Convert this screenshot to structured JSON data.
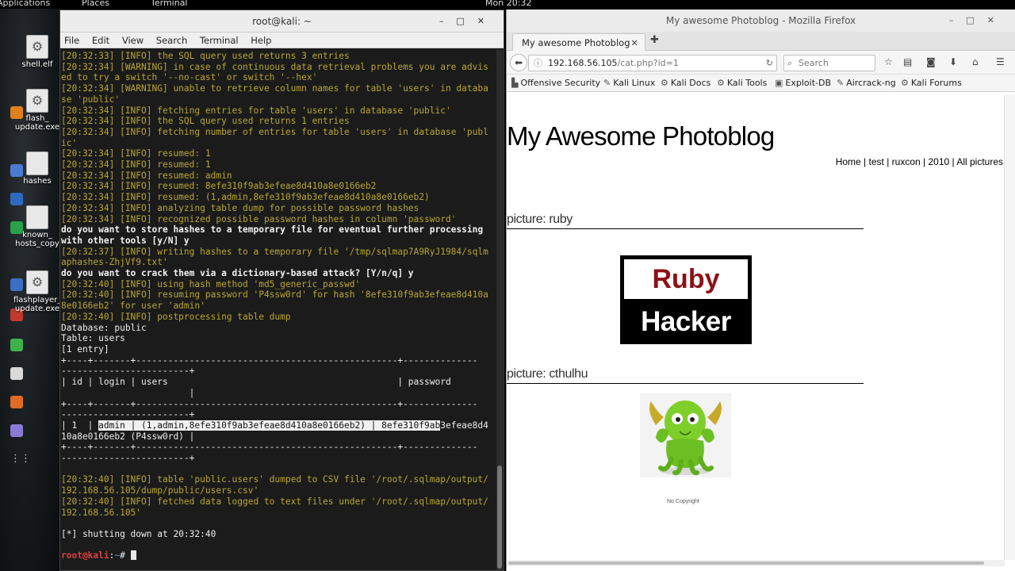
{
  "topbar": {
    "applications": "Applications",
    "places": "Places",
    "terminal": "Terminal",
    "clock": "Mon 20:32"
  },
  "desktop_icons": [
    {
      "label": "shell.elf",
      "icon": "gear-icon"
    },
    {
      "label": "flash_\nupdate.exe",
      "icon": "gear-icon"
    },
    {
      "label": "hashes",
      "icon": "document-icon"
    },
    {
      "label": "known_\nhosts_copy",
      "icon": "document-icon"
    },
    {
      "label": "flashplayer_\nupdate.exe",
      "icon": "gear-icon"
    }
  ],
  "terminal": {
    "title": "root@kali: ~",
    "menu": [
      "File",
      "Edit",
      "View",
      "Search",
      "Terminal",
      "Help"
    ],
    "lines": [
      {
        "c": "y",
        "t": "[20:32:33] [INFO] the SQL query used returns 3 entries"
      },
      {
        "c": "y",
        "t": "[20:32:34] [WARNING] in case of continuous data retrieval problems you are advis"
      },
      {
        "c": "y",
        "t": "ed to try a switch '--no-cast' or switch '--hex'"
      },
      {
        "c": "y",
        "t": "[20:32:34] [WARNING] unable to retrieve column names for table 'users' in databa"
      },
      {
        "c": "y",
        "t": "se 'public'"
      },
      {
        "c": "y",
        "t": "[20:32:34] [INFO] fetching entries for table 'users' in database 'public'"
      },
      {
        "c": "y",
        "t": "[20:32:34] [INFO] the SQL query used returns 1 entries"
      },
      {
        "c": "y",
        "t": "[20:32:34] [INFO] fetching number of entries for table 'users' in database 'publ"
      },
      {
        "c": "y",
        "t": "ic'"
      },
      {
        "c": "y",
        "t": "[20:32:34] [INFO] resumed: 1"
      },
      {
        "c": "y",
        "t": "[20:32:34] [INFO] resumed: 1"
      },
      {
        "c": "y",
        "t": "[20:32:34] [INFO] resumed: admin"
      },
      {
        "c": "y",
        "t": "[20:32:34] [INFO] resumed: 8efe310f9ab3efeae8d410a8e0166eb2"
      },
      {
        "c": "y",
        "t": "[20:32:34] [INFO] resumed: (1,admin,8efe310f9ab3efeae8d410a8e0166eb2)"
      },
      {
        "c": "y",
        "t": "[20:32:34] [INFO] analyzing table dump for possible password hashes"
      },
      {
        "c": "y",
        "t": "[20:32:34] [INFO] recognized possible password hashes in column 'password'"
      },
      {
        "c": "w",
        "t": "do you want to store hashes to a temporary file for eventual further processing"
      },
      {
        "c": "w",
        "t": "with other tools [y/N] y"
      },
      {
        "c": "y",
        "t": "[20:32:37] [INFO] writing hashes to a temporary file '/tmp/sqlmap7A9RyJ1984/sqlm"
      },
      {
        "c": "y",
        "t": "aphashes-ZhjVf9.txt'"
      },
      {
        "c": "w",
        "t": "do you want to crack them via a dictionary-based attack? [Y/n/q] y"
      },
      {
        "c": "y",
        "t": "[20:32:40] [INFO] using hash method 'md5_generic_passwd'"
      },
      {
        "c": "y",
        "t": "[20:32:40] [INFO] resuming password 'P4ssw0rd' for hash '8efe310f9ab3efeae8d410a"
      },
      {
        "c": "y",
        "t": "8e0166eb2' for user 'admin'"
      },
      {
        "c": "y",
        "t": "[20:32:40] [INFO] postprocessing table dump"
      },
      {
        "c": "n",
        "t": "Database: public"
      },
      {
        "c": "n",
        "t": "Table: users"
      },
      {
        "c": "n",
        "t": "[1 entry]"
      },
      {
        "c": "n",
        "t": "+----+-------+-------------------------------------------------+--------------"
      },
      {
        "c": "n",
        "t": "------------------------+"
      },
      {
        "c": "n",
        "t": "| id | login | users                                           | password"
      },
      {
        "c": "n",
        "t": "                        |"
      },
      {
        "c": "n",
        "t": "+----+-------+-------------------------------------------------+--------------"
      },
      {
        "c": "n",
        "t": "------------------------+"
      },
      {
        "c": "sel",
        "pre": "| 1  | ",
        "sel": "admin | (1,admin,8efe310f9ab3efeae8d410a8e0166eb2) | 8efe310f9ab",
        "post": "3efeae8d4"
      },
      {
        "c": "n",
        "t": "10a8e0166eb2 (P4ssw0rd) |"
      },
      {
        "c": "n",
        "t": "+----+-------+-------------------------------------------------+--------------"
      },
      {
        "c": "n",
        "t": "------------------------+"
      },
      {
        "c": "n",
        "t": ""
      },
      {
        "c": "y",
        "t": "[20:32:40] [INFO] table 'public.users' dumped to CSV file '/root/.sqlmap/output/"
      },
      {
        "c": "y",
        "t": "192.168.56.105/dump/public/users.csv'"
      },
      {
        "c": "y",
        "t": "[20:32:40] [INFO] fetched data logged to text files under '/root/.sqlmap/output/"
      },
      {
        "c": "y",
        "t": "192.168.56.105'"
      },
      {
        "c": "n",
        "t": ""
      },
      {
        "c": "n",
        "t": "[*] shutting down at 20:32:40"
      },
      {
        "c": "n",
        "t": ""
      },
      {
        "c": "prompt",
        "user": "root@kali",
        "sep": ":",
        "path": "~",
        "sym": "# "
      }
    ]
  },
  "firefox": {
    "window_title": "My awesome Photoblog - Mozilla Firefox",
    "tab_title": "My awesome Photoblog",
    "url_host": "192.168.56.105",
    "url_path": "/cat.php?id=1",
    "search_placeholder": "Search",
    "bookmarks": [
      "Offensive Security",
      "Kali Linux",
      "Kali Docs",
      "Kali Tools",
      "Exploit-DB",
      "Aircrack-ng",
      "Kali Forums"
    ],
    "page": {
      "title": "My Awesome Photoblog",
      "nav": [
        "Home",
        "test",
        "ruxcon",
        "2010",
        "All pictures"
      ],
      "pictures": [
        {
          "heading": "picture: ruby",
          "img_top": "Ruby",
          "img_bottom": "Hacker"
        },
        {
          "heading": "picture: cthulhu"
        }
      ],
      "footer": "No Copyright"
    }
  }
}
